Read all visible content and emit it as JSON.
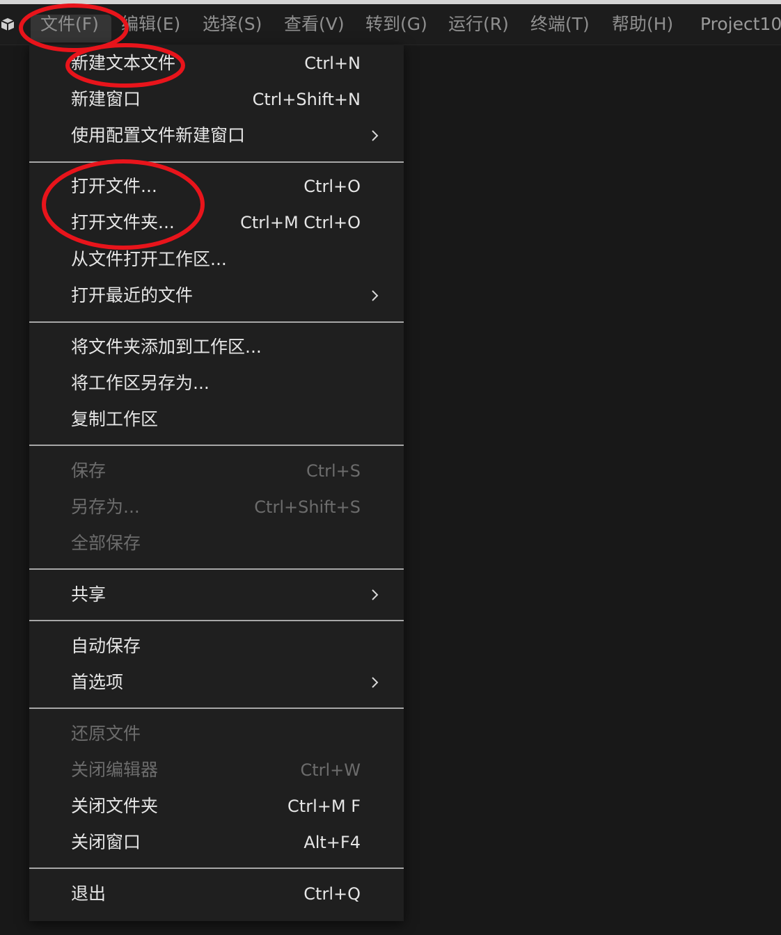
{
  "menubar": {
    "items": [
      {
        "label": "文件(F)"
      },
      {
        "label": "编辑(E)"
      },
      {
        "label": "选择(S)"
      },
      {
        "label": "查看(V)"
      },
      {
        "label": "转到(G)"
      },
      {
        "label": "运行(R)"
      },
      {
        "label": "终端(T)"
      },
      {
        "label": "帮助(H)"
      }
    ],
    "title": "Project10"
  },
  "file_menu": {
    "items": [
      {
        "label": "新建文本文件",
        "shortcut": "Ctrl+N"
      },
      {
        "label": "新建窗口",
        "shortcut": "Ctrl+Shift+N"
      },
      {
        "label": "使用配置文件新建窗口",
        "submenu": true
      },
      {
        "label": "打开文件...",
        "shortcut": "Ctrl+O"
      },
      {
        "label": "打开文件夹...",
        "shortcut": "Ctrl+M Ctrl+O"
      },
      {
        "label": "从文件打开工作区..."
      },
      {
        "label": "打开最近的文件",
        "submenu": true
      },
      {
        "label": "将文件夹添加到工作区..."
      },
      {
        "label": "将工作区另存为..."
      },
      {
        "label": "复制工作区"
      },
      {
        "label": "保存",
        "shortcut": "Ctrl+S",
        "disabled": true
      },
      {
        "label": "另存为...",
        "shortcut": "Ctrl+Shift+S",
        "disabled": true
      },
      {
        "label": "全部保存",
        "disabled": true
      },
      {
        "label": "共享",
        "submenu": true
      },
      {
        "label": "自动保存"
      },
      {
        "label": "首选项",
        "submenu": true
      },
      {
        "label": "还原文件",
        "disabled": true
      },
      {
        "label": "关闭编辑器",
        "shortcut": "Ctrl+W",
        "disabled": true
      },
      {
        "label": "关闭文件夹",
        "shortcut": "Ctrl+M F"
      },
      {
        "label": "关闭窗口",
        "shortcut": "Alt+F4"
      },
      {
        "label": "退出",
        "shortcut": "Ctrl+Q"
      }
    ]
  },
  "annotation_color": "#e8141b",
  "icons": [
    "app-icon",
    "chevron-right-icon"
  ]
}
